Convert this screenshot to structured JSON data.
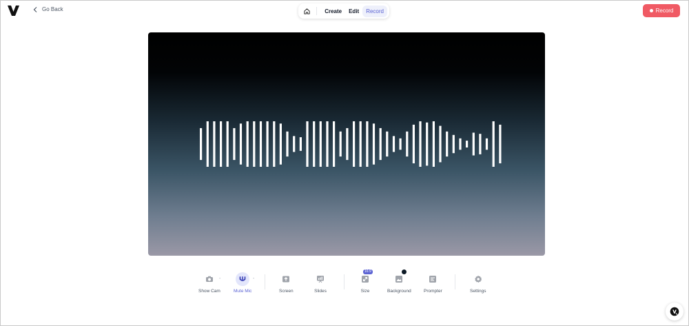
{
  "header": {
    "back_label": "Go Back",
    "nav": {
      "tabs": [
        "Create",
        "Edit",
        "Record"
      ],
      "active": "Record"
    },
    "record_label": "Record",
    "accent": "#5b63d3",
    "record_color": "#f05a64"
  },
  "waveform": {
    "bar_heights": [
      0.7,
      1.0,
      1.0,
      1.0,
      1.0,
      0.7,
      0.9,
      1.0,
      1.0,
      1.0,
      1.0,
      1.0,
      0.9,
      0.55,
      0.35,
      0.3,
      1.0,
      1.0,
      1.0,
      1.0,
      1.0,
      0.55,
      0.7,
      1.0,
      1.0,
      1.0,
      0.9,
      0.7,
      0.55,
      0.35,
      0.25,
      0.55,
      0.85,
      1.0,
      0.95,
      1.0,
      0.8,
      0.55,
      0.4,
      0.25,
      0.15,
      0.5,
      0.45,
      0.25,
      1.0,
      0.85
    ]
  },
  "toolbar": {
    "show_cam": "Show Cam",
    "mute_mic": "Mute Mic",
    "screen": "Screen",
    "slides": "Slides",
    "size": "Size",
    "size_badge": "16:9",
    "background": "Background",
    "prompter": "Prompter",
    "settings": "Settings",
    "dash": "-"
  },
  "icons": {
    "logo": "v-logo-icon",
    "back": "chevron-left-icon",
    "home": "home-icon",
    "camera": "camera-icon",
    "mic": "microphone-icon",
    "screen": "screen-share-icon",
    "slides": "slides-icon",
    "size": "resize-icon",
    "background": "image-icon",
    "prompter": "prompter-icon",
    "settings": "gear-icon",
    "help": "help-chat-icon"
  }
}
